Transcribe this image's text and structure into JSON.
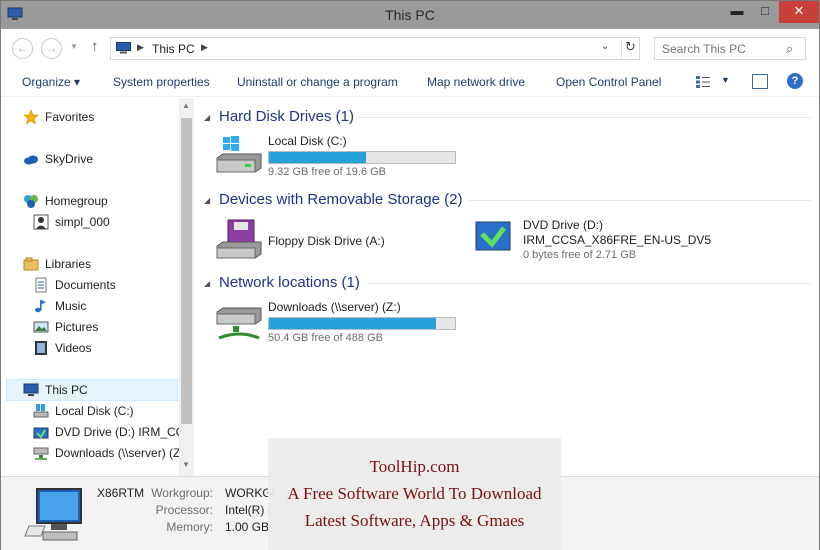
{
  "window": {
    "title": "This PC",
    "icons": {
      "app": "computer-icon",
      "minimize": "minimize-icon",
      "maximize": "maximize-icon",
      "close": "close-icon"
    },
    "min_glyph": "▬",
    "max_glyph": "□",
    "close_glyph": "✕"
  },
  "address": {
    "back_glyph": "←",
    "forward_glyph": "→",
    "recent_glyph": "▼",
    "up_glyph": "↑",
    "crumbs": [
      "This PC"
    ],
    "crumb_separator": "▶",
    "dropdown_glyph": "⌄",
    "refresh_glyph": "↻",
    "search_placeholder": "Search This PC",
    "search_glyph": "⌕"
  },
  "command_bar": {
    "organize": "Organize ▾",
    "system_properties": "System properties",
    "uninstall": "Uninstall or change a program",
    "map_network_drive": "Map network drive",
    "open_control_panel": "Open Control Panel",
    "views_arrow": "▼",
    "help_glyph": "?"
  },
  "nav_pane": {
    "favorites": "Favorites",
    "skydrive": "SkyDrive",
    "homegroup": "Homegroup",
    "user": "simpl_000",
    "libraries": "Libraries",
    "documents": "Documents",
    "music": "Music",
    "pictures": "Pictures",
    "videos": "Videos",
    "this_pc": "This PC",
    "local_disk": "Local Disk (C:)",
    "dvd_drive": "DVD Drive (D:) IRM_CCS",
    "downloads": "Downloads (\\\\server) (Z"
  },
  "groups": {
    "hard_disk": "Hard Disk Drives (1)",
    "removable": "Devices with Removable Storage (2)",
    "network": "Network locations (1)"
  },
  "drives": {
    "local_c": {
      "name": "Local Disk (C:)",
      "info": "9.32 GB free of 19.6 GB",
      "used_fraction": 0.52
    },
    "floppy": {
      "name": "Floppy Disk Drive (A:)"
    },
    "dvd": {
      "name": "DVD Drive (D:)",
      "label": "IRM_CCSA_X86FRE_EN-US_DV5",
      "info": "0 bytes free of 2.71 GB"
    },
    "downloads_z": {
      "name": "Downloads (\\\\server) (Z:)",
      "info": "50.4 GB free of 488 GB",
      "used_fraction": 0.9
    }
  },
  "details": {
    "computer_name": "X86RTM",
    "workgroup_label": "Workgroup:",
    "workgroup_value": "WORKGI",
    "processor_label": "Processor:",
    "processor_value": "Intel(R) (",
    "memory_label": "Memory:",
    "memory_value": "1.00 GB"
  },
  "watermark": {
    "line1": "ToolHip.com",
    "line2": "A Free Software World To Download",
    "line3": "Latest Software, Apps & Gmaes"
  },
  "colors": {
    "accent": "#26a0da",
    "group_header": "#1e3287",
    "close_button": "#c7403a",
    "watermark_text": "#7a1010"
  }
}
